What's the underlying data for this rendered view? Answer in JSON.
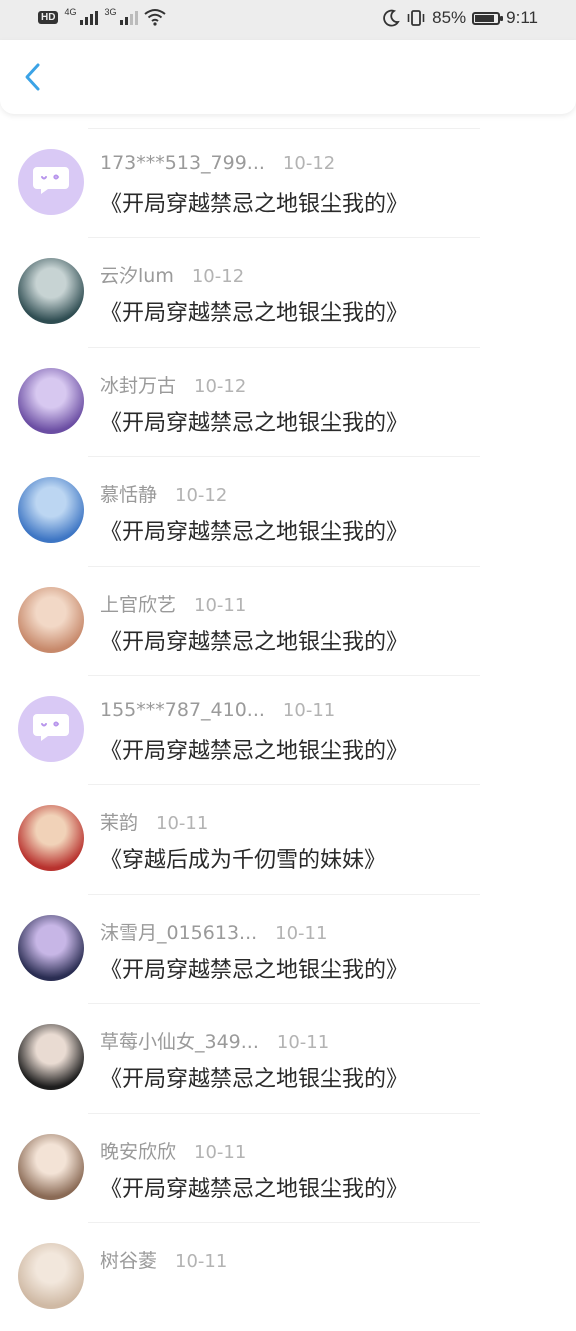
{
  "status_bar": {
    "network_left": "HD",
    "network_4g": "4G",
    "network_3g": "3G",
    "battery_pct": "85%",
    "time": "9:11",
    "battery_level": 0.85
  },
  "header": {
    "back_icon": "chevron-left-icon"
  },
  "comments": [
    {
      "user": "173***513_799...",
      "date": "10-12",
      "text": "《开局穿越禁忌之地银尘我的》",
      "avatar": "default-chat",
      "colors": [
        "#d9c9f5",
        "#b794ec"
      ]
    },
    {
      "user": "云汐lum",
      "date": "10-12",
      "text": "《开局穿越禁忌之地银尘我的》",
      "avatar": "photo",
      "colors": [
        "#2f4d52",
        "#c7d3d3"
      ]
    },
    {
      "user": "冰封万古",
      "date": "10-12",
      "text": "《开局穿越禁忌之地银尘我的》",
      "avatar": "photo",
      "colors": [
        "#6b4ea3",
        "#d7c8f0"
      ]
    },
    {
      "user": "慕恬静",
      "date": "10-12",
      "text": "《开局穿越禁忌之地银尘我的》",
      "avatar": "photo",
      "colors": [
        "#3e76c4",
        "#bcd6f2"
      ]
    },
    {
      "user": "上官欣艺",
      "date": "10-11",
      "text": "《开局穿越禁忌之地银尘我的》",
      "avatar": "photo",
      "colors": [
        "#c7896b",
        "#f2d8c6"
      ]
    },
    {
      "user": "155***787_410...",
      "date": "10-11",
      "text": "《开局穿越禁忌之地银尘我的》",
      "avatar": "default-chat",
      "colors": [
        "#d9c9f5",
        "#b794ec"
      ]
    },
    {
      "user": "茉韵",
      "date": "10-11",
      "text": "《穿越后成为千仞雪的妹妹》",
      "avatar": "photo",
      "colors": [
        "#b8322e",
        "#f1d2b8"
      ]
    },
    {
      "user": "沫雪月_015613...",
      "date": "10-11",
      "text": "《开局穿越禁忌之地银尘我的》",
      "avatar": "photo",
      "colors": [
        "#2a2d52",
        "#c7b6e6"
      ]
    },
    {
      "user": "草莓小仙女_349...",
      "date": "10-11",
      "text": "《开局穿越禁忌之地银尘我的》",
      "avatar": "photo",
      "colors": [
        "#1d1d1d",
        "#e9dbd2"
      ]
    },
    {
      "user": "晚安欣欣",
      "date": "10-11",
      "text": "《开局穿越禁忌之地银尘我的》",
      "avatar": "photo",
      "colors": [
        "#8a6a55",
        "#f3e3d6"
      ]
    },
    {
      "user": "树谷菱",
      "date": "10-11",
      "text": "",
      "avatar": "photo",
      "colors": [
        "#cfb9a4",
        "#f2e7dc"
      ]
    }
  ]
}
